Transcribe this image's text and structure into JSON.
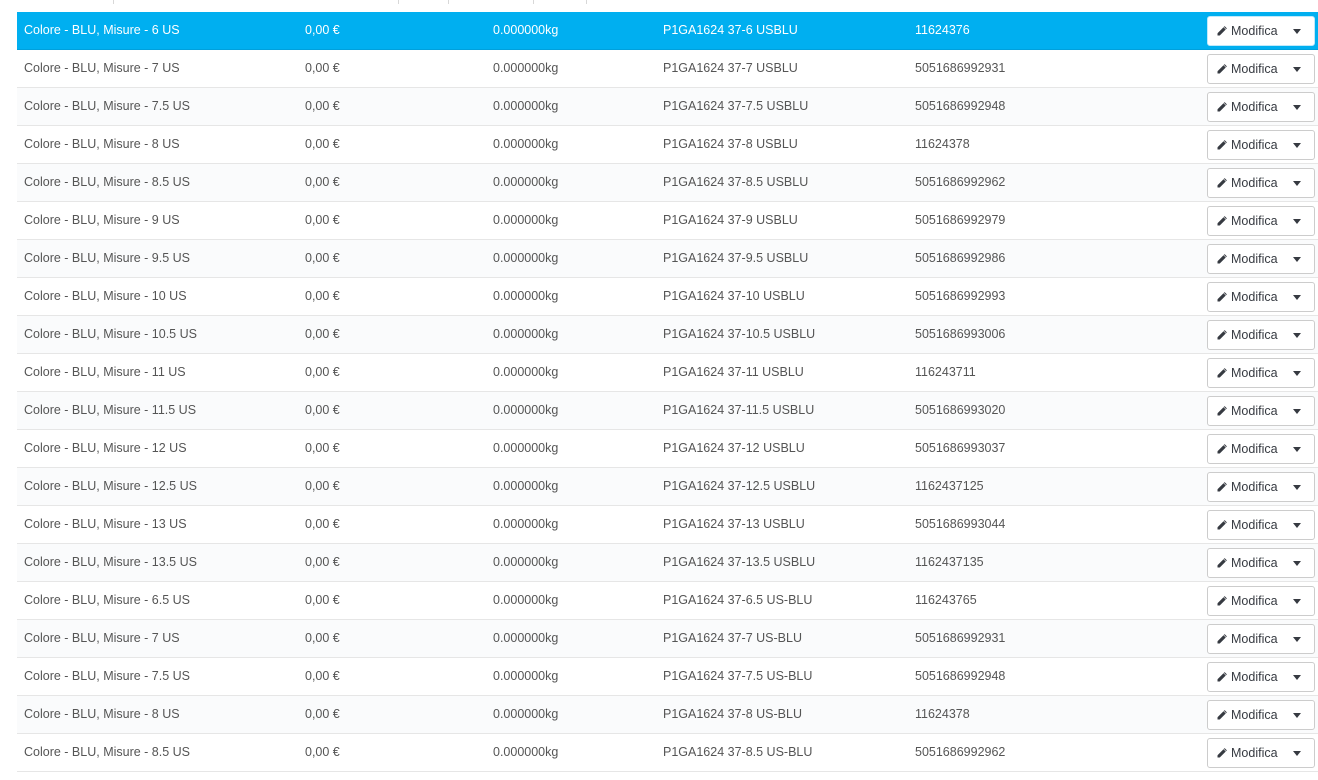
{
  "combinations": {
    "edit_label": "Modifica",
    "rows": [
      {
        "name": "Colore - BLU, Misure - 6 US",
        "price": "0,00 €",
        "weight": "0.000000kg",
        "reference": "P1GA1624 37-6 USBLU",
        "ean": "11624376",
        "selected": true
      },
      {
        "name": "Colore - BLU, Misure - 7 US",
        "price": "0,00 €",
        "weight": "0.000000kg",
        "reference": "P1GA1624 37-7 USBLU",
        "ean": "5051686992931"
      },
      {
        "name": "Colore - BLU, Misure - 7.5 US",
        "price": "0,00 €",
        "weight": "0.000000kg",
        "reference": "P1GA1624 37-7.5 USBLU",
        "ean": "5051686992948"
      },
      {
        "name": "Colore - BLU, Misure - 8 US",
        "price": "0,00 €",
        "weight": "0.000000kg",
        "reference": "P1GA1624 37-8 USBLU",
        "ean": "11624378"
      },
      {
        "name": "Colore - BLU, Misure - 8.5 US",
        "price": "0,00 €",
        "weight": "0.000000kg",
        "reference": "P1GA1624 37-8.5 USBLU",
        "ean": "5051686992962"
      },
      {
        "name": "Colore - BLU, Misure - 9 US",
        "price": "0,00 €",
        "weight": "0.000000kg",
        "reference": "P1GA1624 37-9 USBLU",
        "ean": "5051686992979"
      },
      {
        "name": "Colore - BLU, Misure - 9.5 US",
        "price": "0,00 €",
        "weight": "0.000000kg",
        "reference": "P1GA1624 37-9.5 USBLU",
        "ean": "5051686992986"
      },
      {
        "name": "Colore - BLU, Misure - 10 US",
        "price": "0,00 €",
        "weight": "0.000000kg",
        "reference": "P1GA1624 37-10 USBLU",
        "ean": "5051686992993"
      },
      {
        "name": "Colore - BLU, Misure - 10.5 US",
        "price": "0,00 €",
        "weight": "0.000000kg",
        "reference": "P1GA1624 37-10.5 USBLU",
        "ean": "5051686993006"
      },
      {
        "name": "Colore - BLU, Misure - 11 US",
        "price": "0,00 €",
        "weight": "0.000000kg",
        "reference": "P1GA1624 37-11 USBLU",
        "ean": "116243711"
      },
      {
        "name": "Colore - BLU, Misure - 11.5 US",
        "price": "0,00 €",
        "weight": "0.000000kg",
        "reference": "P1GA1624 37-11.5 USBLU",
        "ean": "5051686993020"
      },
      {
        "name": "Colore - BLU, Misure - 12 US",
        "price": "0,00 €",
        "weight": "0.000000kg",
        "reference": "P1GA1624 37-12 USBLU",
        "ean": "5051686993037"
      },
      {
        "name": "Colore - BLU, Misure - 12.5 US",
        "price": "0,00 €",
        "weight": "0.000000kg",
        "reference": "P1GA1624 37-12.5 USBLU",
        "ean": "1162437125"
      },
      {
        "name": "Colore - BLU, Misure - 13 US",
        "price": "0,00 €",
        "weight": "0.000000kg",
        "reference": "P1GA1624 37-13 USBLU",
        "ean": "5051686993044"
      },
      {
        "name": "Colore - BLU, Misure - 13.5 US",
        "price": "0,00 €",
        "weight": "0.000000kg",
        "reference": "P1GA1624 37-13.5 USBLU",
        "ean": "1162437135"
      },
      {
        "name": "Colore - BLU, Misure - 6.5 US",
        "price": "0,00 €",
        "weight": "0.000000kg",
        "reference": "P1GA1624 37-6.5 US-BLU",
        "ean": "116243765"
      },
      {
        "name": "Colore - BLU, Misure - 7 US",
        "price": "0,00 €",
        "weight": "0.000000kg",
        "reference": "P1GA1624 37-7 US-BLU",
        "ean": "5051686992931"
      },
      {
        "name": "Colore - BLU, Misure - 7.5 US",
        "price": "0,00 €",
        "weight": "0.000000kg",
        "reference": "P1GA1624 37-7.5 US-BLU",
        "ean": "5051686992948"
      },
      {
        "name": "Colore - BLU, Misure - 8 US",
        "price": "0,00 €",
        "weight": "0.000000kg",
        "reference": "P1GA1624 37-8 US-BLU",
        "ean": "11624378"
      },
      {
        "name": "Colore - BLU, Misure - 8.5 US",
        "price": "0,00 €",
        "weight": "0.000000kg",
        "reference": "P1GA1624 37-8.5 US-BLU",
        "ean": "5051686992962"
      }
    ]
  },
  "icons": {
    "edit": "pencil-icon",
    "dropdown": "caret-down-icon"
  },
  "colors": {
    "selected_row": "#00aff0",
    "row_alt": "#fafbfc",
    "text": "#555555"
  }
}
